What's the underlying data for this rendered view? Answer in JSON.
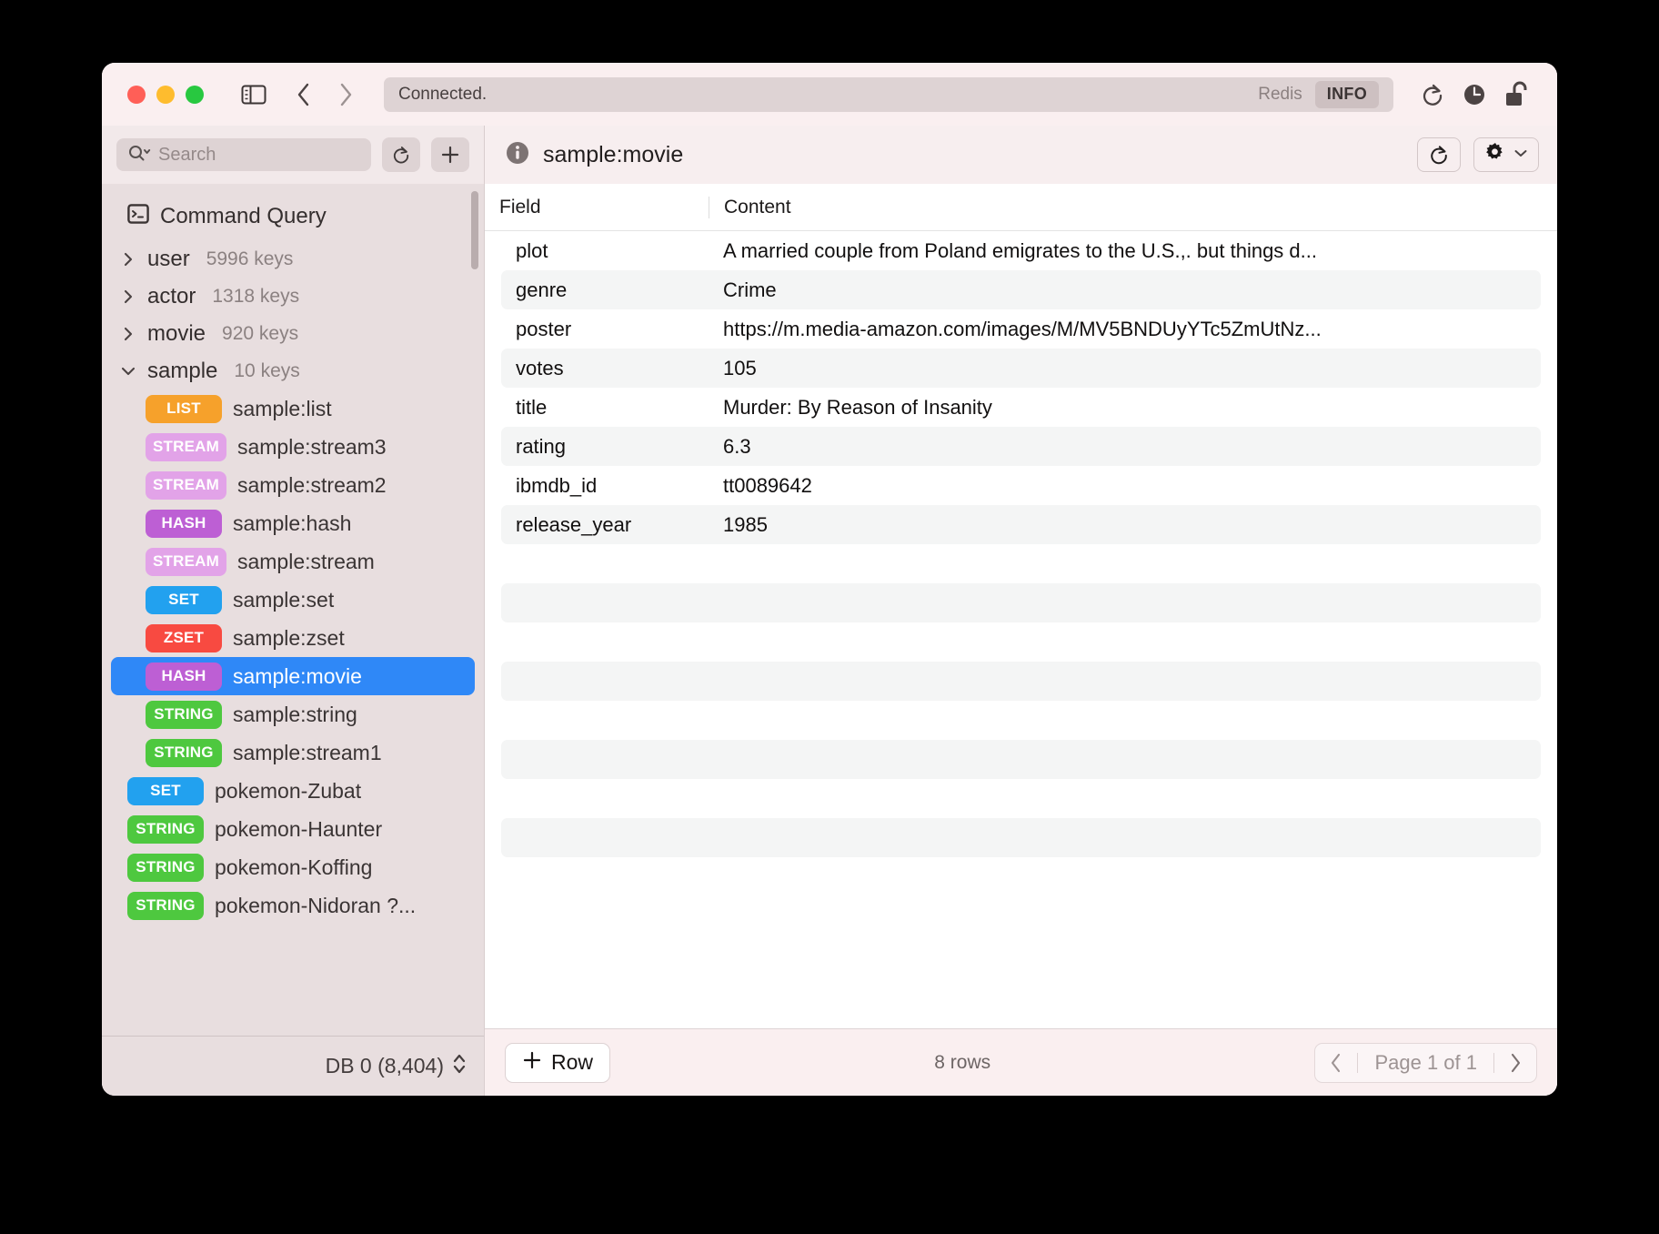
{
  "titlebar": {
    "status_text": "Connected.",
    "redis_label": "Redis",
    "info_badge": "INFO",
    "icons": {
      "sidebar_toggle": "sidebar-toggle-icon",
      "back": "chevron-left-icon",
      "forward": "chevron-right-icon",
      "refresh": "refresh-icon",
      "history": "clock-icon",
      "lock": "unlocked-padlock-icon"
    }
  },
  "sidebar": {
    "search": {
      "placeholder": "Search",
      "icon": "search-icon"
    },
    "refresh_icon": "refresh-icon",
    "add_icon": "plus-icon",
    "command_query": {
      "label": "Command Query",
      "icon": "terminal-icon"
    },
    "groups": [
      {
        "name": "user",
        "count": "5996 keys",
        "expanded": false
      },
      {
        "name": "actor",
        "count": "1318 keys",
        "expanded": false
      },
      {
        "name": "movie",
        "count": "920 keys",
        "expanded": false
      },
      {
        "name": "sample",
        "count": "10 keys",
        "expanded": true
      }
    ],
    "keys": [
      {
        "type": "LIST",
        "name": "sample:list",
        "level": 1,
        "selected": false
      },
      {
        "type": "STREAM",
        "name": "sample:stream3",
        "level": 1,
        "selected": false
      },
      {
        "type": "STREAM",
        "name": "sample:stream2",
        "level": 1,
        "selected": false
      },
      {
        "type": "HASH",
        "name": "sample:hash",
        "level": 1,
        "selected": false
      },
      {
        "type": "STREAM",
        "name": "sample:stream",
        "level": 1,
        "selected": false
      },
      {
        "type": "SET",
        "name": "sample:set",
        "level": 1,
        "selected": false
      },
      {
        "type": "ZSET",
        "name": "sample:zset",
        "level": 1,
        "selected": false
      },
      {
        "type": "HASH",
        "name": "sample:movie",
        "level": 1,
        "selected": true
      },
      {
        "type": "STRING",
        "name": "sample:string",
        "level": 1,
        "selected": false
      },
      {
        "type": "STRING",
        "name": "sample:stream1",
        "level": 1,
        "selected": false
      },
      {
        "type": "SET",
        "name": "pokemon-Zubat",
        "level": 0,
        "selected": false
      },
      {
        "type": "STRING",
        "name": "pokemon-Haunter",
        "level": 0,
        "selected": false
      },
      {
        "type": "STRING",
        "name": "pokemon-Koffing",
        "level": 0,
        "selected": false
      },
      {
        "type": "STRING",
        "name": "pokemon-Nidoran ?...",
        "level": 0,
        "selected": false
      }
    ],
    "db_label": "DB 0 (8,404)"
  },
  "type_colors": {
    "LIST": "#f6a12b",
    "STREAM": "#e2a3e8",
    "HASH": "#bd5fd4",
    "SET": "#22a1ef",
    "ZSET": "#f84a41",
    "STRING": "#4ec83f"
  },
  "main": {
    "info_icon": "info-icon",
    "key_title": "sample:movie",
    "refresh_icon": "refresh-icon",
    "settings_icon": "gear-icon",
    "settings_chevron": "chevron-down-icon",
    "columns": [
      "Field",
      "Content"
    ],
    "rows": [
      {
        "field": "plot",
        "content": "A married couple from Poland emigrates to the U.S.,. but things d..."
      },
      {
        "field": "genre",
        "content": "Crime"
      },
      {
        "field": "poster",
        "content": "https://m.media-amazon.com/images/M/MV5BNDUyYTc5ZmUtNz..."
      },
      {
        "field": "votes",
        "content": "105"
      },
      {
        "field": "title",
        "content": "Murder: By Reason of Insanity"
      },
      {
        "field": "rating",
        "content": "6.3"
      },
      {
        "field": "ibmdb_id",
        "content": "tt0089642"
      },
      {
        "field": "release_year",
        "content": "1985"
      }
    ],
    "empty_row_count": 8,
    "footer": {
      "add_row_label": "Row",
      "add_icon": "plus-icon",
      "rows_count": "8 rows",
      "page_label": "Page 1 of 1",
      "prev_icon": "chevron-left-icon",
      "next_icon": "chevron-right-icon"
    }
  }
}
